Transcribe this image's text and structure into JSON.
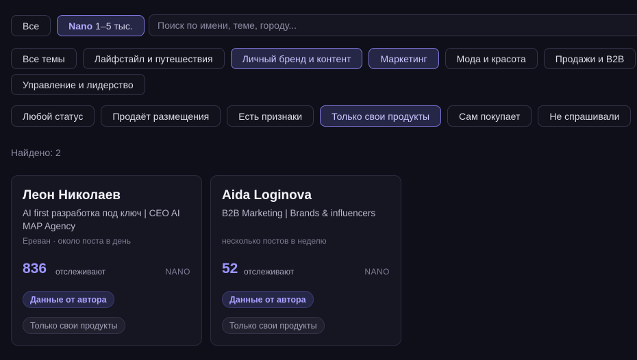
{
  "filters": {
    "size": [
      {
        "label": "Все",
        "accent": "",
        "active": false
      },
      {
        "label": "1–5 тыс.",
        "accent": "Nano",
        "active": true
      }
    ],
    "search_placeholder": "Поиск по имени, теме, городу...",
    "topics": [
      {
        "label": "Все темы",
        "active": false
      },
      {
        "label": "Лайфстайл и путешествия",
        "active": false
      },
      {
        "label": "Личный бренд и контент",
        "active": true
      },
      {
        "label": "Маркетинг",
        "active": true
      },
      {
        "label": "Мода и красота",
        "active": false
      },
      {
        "label": "Продажи и B2B",
        "active": false
      },
      {
        "label": "Управление и лидерство",
        "active": false
      }
    ],
    "statuses": [
      {
        "label": "Любой статус",
        "active": false
      },
      {
        "label": "Продаёт размещения",
        "active": false
      },
      {
        "label": "Есть признаки",
        "active": false
      },
      {
        "label": "Только свои продукты",
        "active": true
      },
      {
        "label": "Сам покупает",
        "active": false
      },
      {
        "label": "Не спрашивали",
        "active": false
      }
    ]
  },
  "results": {
    "found_label": "Найдено: 2"
  },
  "cards": [
    {
      "name": "Леон Николаев",
      "bio": "AI first разработка под ключ | CEO AI MAP Agency",
      "meta": "Ереван · около поста в день",
      "followers": "836",
      "followers_label": "отслеживают",
      "tier": "NANO",
      "badge_author": "Данные от автора",
      "badge_status": "Только свои продукты"
    },
    {
      "name": "Aida Loginova",
      "bio": "B2B Marketing | Brands & influencers",
      "meta": "несколько постов в неделю",
      "followers": "52",
      "followers_label": "отслеживают",
      "tier": "NANO",
      "badge_author": "Данные от автора",
      "badge_status": "Только свои продукты"
    }
  ],
  "colors": {
    "background": "#0f0f19",
    "accent": "#9d96ff",
    "active_chip_bg": "#262646",
    "active_chip_border": "#7f79dc"
  }
}
